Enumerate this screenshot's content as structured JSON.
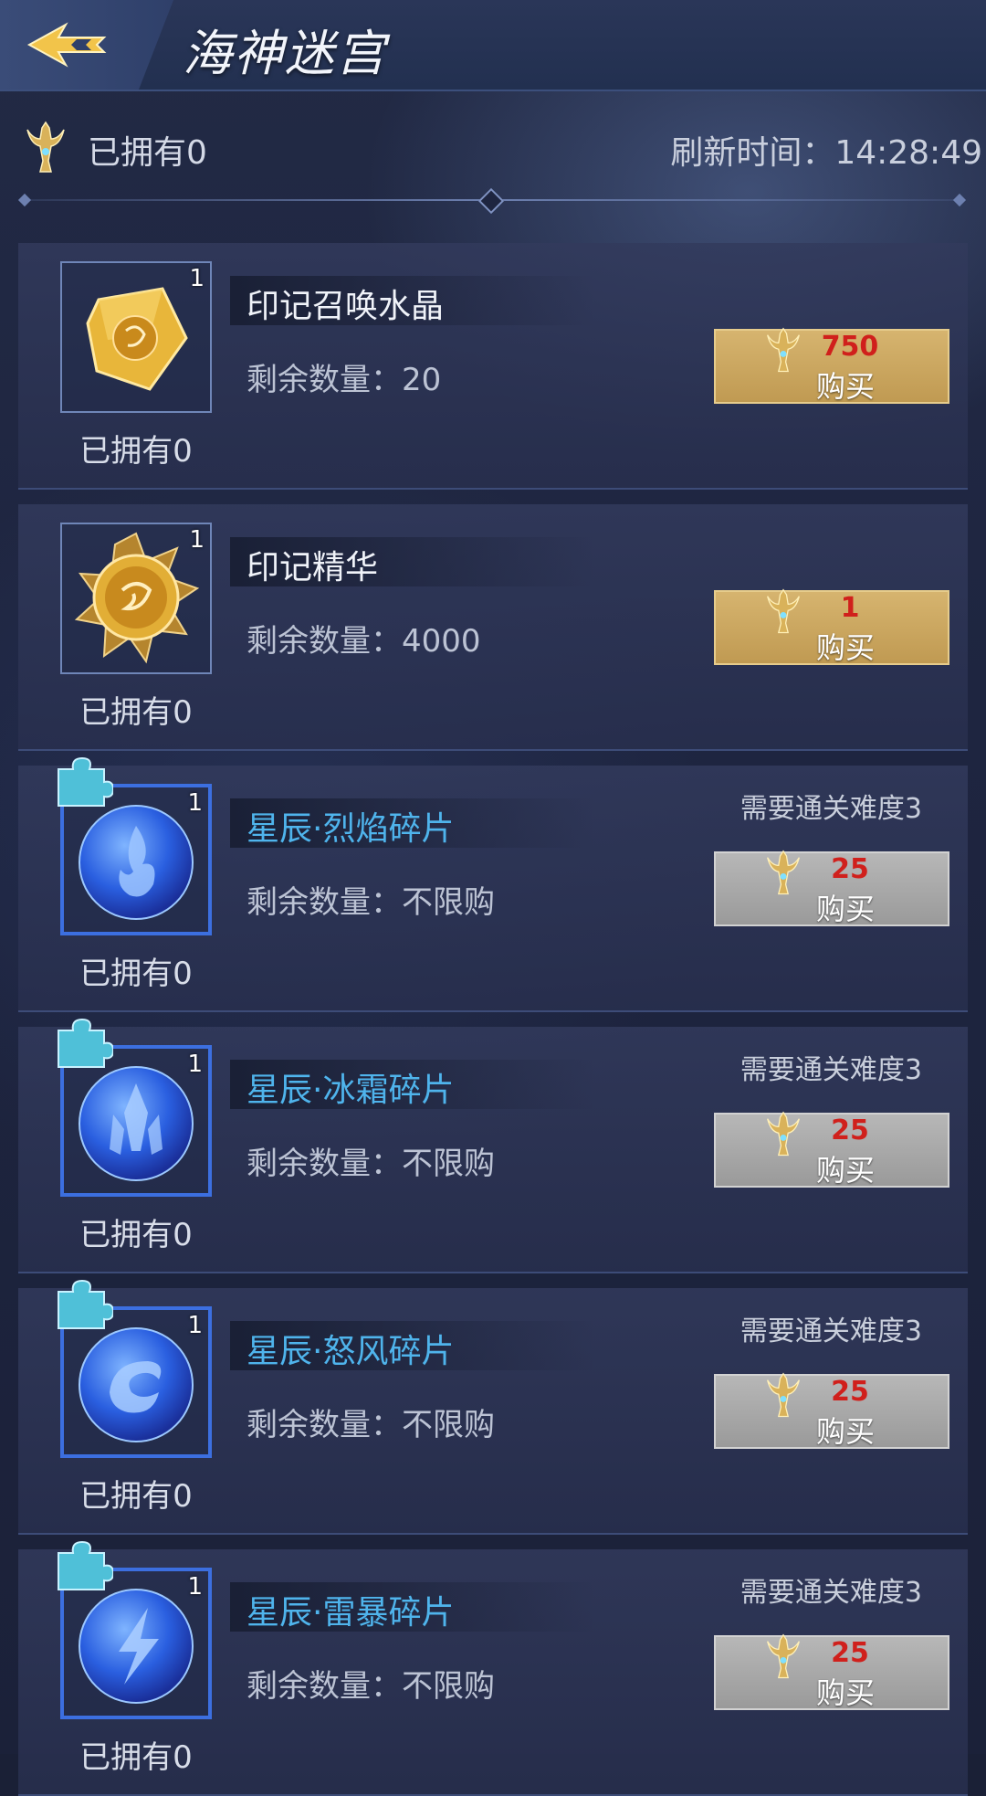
{
  "header": {
    "title": "海神迷宫"
  },
  "status": {
    "owned": "已拥有0",
    "refresh": "刷新时间：14:28:49"
  },
  "items": [
    {
      "name": "印记召唤水晶",
      "remain": "剩余数量：20",
      "owned": "已拥有0",
      "qty": "1",
      "price": "750",
      "buy": "购买",
      "requirement": "",
      "icon": "gold-crystal-icon"
    },
    {
      "name": "印记精华",
      "remain": "剩余数量：4000",
      "owned": "已拥有0",
      "qty": "1",
      "price": "1",
      "buy": "购买",
      "requirement": "",
      "icon": "gold-coin-icon"
    },
    {
      "name": "星辰·烈焰碎片",
      "remain": "剩余数量：不限购",
      "owned": "已拥有0",
      "qty": "1",
      "price": "25",
      "buy": "购买",
      "requirement": "需要通关难度3",
      "icon": "flame-orb-icon"
    },
    {
      "name": "星辰·冰霜碎片",
      "remain": "剩余数量：不限购",
      "owned": "已拥有0",
      "qty": "1",
      "price": "25",
      "buy": "购买",
      "requirement": "需要通关难度3",
      "icon": "frost-orb-icon"
    },
    {
      "name": "星辰·怒风碎片",
      "remain": "剩余数量：不限购",
      "owned": "已拥有0",
      "qty": "1",
      "price": "25",
      "buy": "购买",
      "requirement": "需要通关难度3",
      "icon": "wind-orb-icon"
    },
    {
      "name": "星辰·雷暴碎片",
      "remain": "剩余数量：不限购",
      "owned": "已拥有0",
      "qty": "1",
      "price": "25",
      "buy": "购买",
      "requirement": "需要通关难度3",
      "icon": "thunder-orb-icon"
    }
  ],
  "colors": {
    "gold_button": "#c9a55e",
    "gray_button": "#a8a8a8",
    "price_red": "#d0201c",
    "fragment_name_blue": "#4fb4ec"
  }
}
